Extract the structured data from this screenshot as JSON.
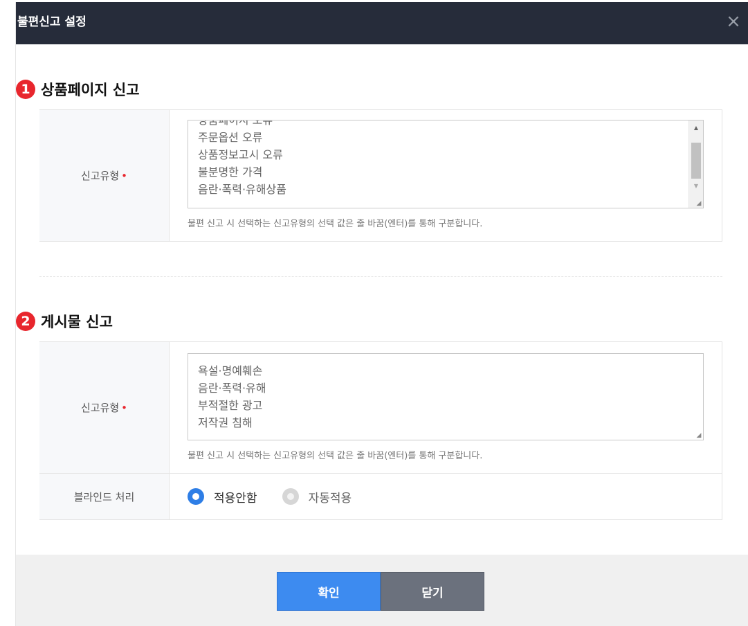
{
  "dialog": {
    "title": "불편신고 설정",
    "close_icon": "×"
  },
  "section1": {
    "badge": "1",
    "title": "상품페이지 신고",
    "field_label": "신고유형",
    "required_mark": "•",
    "textarea_lines": [
      "상품페이지 오류",
      "주문옵션 오류",
      "상품정보고시 오류",
      "불분명한 가격",
      "음란·폭력·유해상품"
    ],
    "help": "불편 신고 시 선택하는 신고유형의 선택 값은 줄 바꿈(엔터)를 통해 구분합니다."
  },
  "section2": {
    "badge": "2",
    "title": "게시물 신고",
    "field_label": "신고유형",
    "required_mark": "•",
    "textarea_lines": [
      "욕설·명예훼손",
      "음란·폭력·유해",
      "부적절한 광고",
      "저작권 침해"
    ],
    "help": "불편 신고 시 선택하는 신고유형의 선택 값은 줄 바꿈(엔터)를 통해 구분합니다.",
    "blind_label": "블라인드 처리",
    "blind_options": [
      {
        "label": "적용안함",
        "selected": true
      },
      {
        "label": "자동적용",
        "selected": false
      }
    ]
  },
  "footer": {
    "confirm_label": "확인",
    "close_label": "닫기"
  },
  "colors": {
    "titlebar": "#262c3a",
    "badge": "#e8262d",
    "confirm": "#3d8bf0",
    "close": "#6b717d",
    "radio_selected": "#2e7ee6"
  }
}
